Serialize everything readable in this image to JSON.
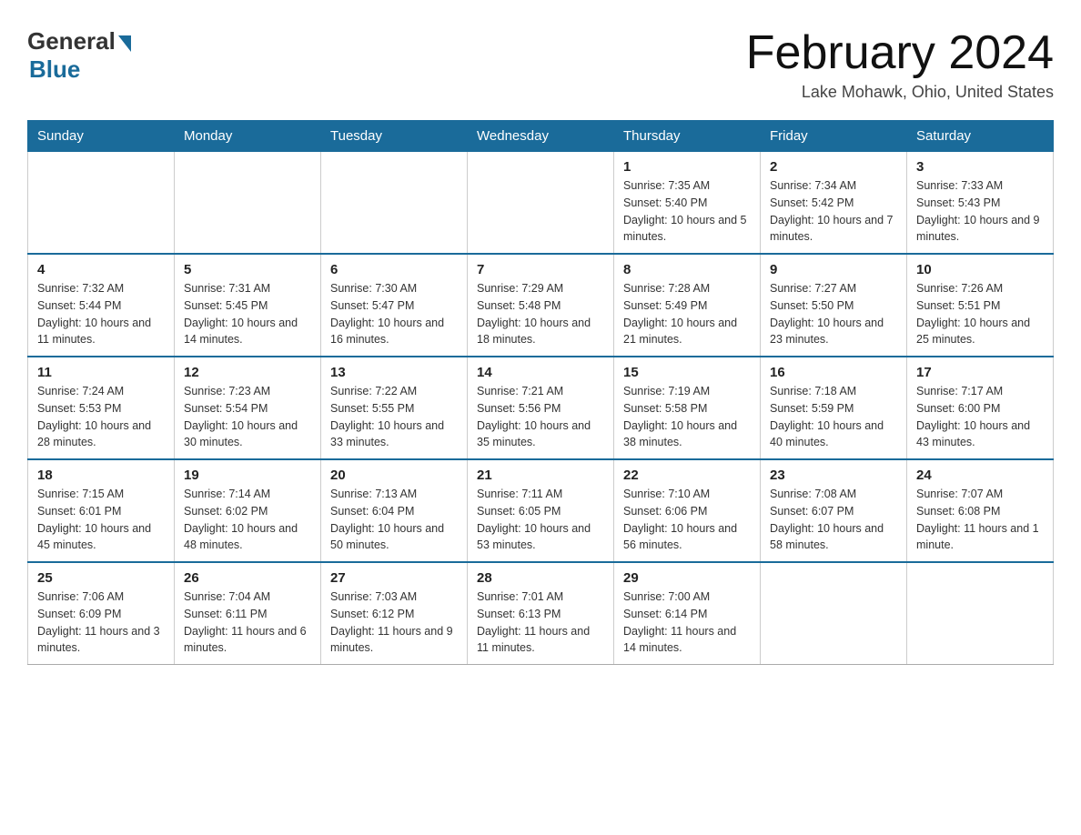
{
  "header": {
    "logo": {
      "text_general": "General",
      "text_blue": "Blue"
    },
    "title": "February 2024",
    "location": "Lake Mohawk, Ohio, United States"
  },
  "days_of_week": [
    "Sunday",
    "Monday",
    "Tuesday",
    "Wednesday",
    "Thursday",
    "Friday",
    "Saturday"
  ],
  "weeks": [
    {
      "days": [
        {
          "number": "",
          "info": ""
        },
        {
          "number": "",
          "info": ""
        },
        {
          "number": "",
          "info": ""
        },
        {
          "number": "",
          "info": ""
        },
        {
          "number": "1",
          "info": "Sunrise: 7:35 AM\nSunset: 5:40 PM\nDaylight: 10 hours and 5 minutes."
        },
        {
          "number": "2",
          "info": "Sunrise: 7:34 AM\nSunset: 5:42 PM\nDaylight: 10 hours and 7 minutes."
        },
        {
          "number": "3",
          "info": "Sunrise: 7:33 AM\nSunset: 5:43 PM\nDaylight: 10 hours and 9 minutes."
        }
      ]
    },
    {
      "days": [
        {
          "number": "4",
          "info": "Sunrise: 7:32 AM\nSunset: 5:44 PM\nDaylight: 10 hours and 11 minutes."
        },
        {
          "number": "5",
          "info": "Sunrise: 7:31 AM\nSunset: 5:45 PM\nDaylight: 10 hours and 14 minutes."
        },
        {
          "number": "6",
          "info": "Sunrise: 7:30 AM\nSunset: 5:47 PM\nDaylight: 10 hours and 16 minutes."
        },
        {
          "number": "7",
          "info": "Sunrise: 7:29 AM\nSunset: 5:48 PM\nDaylight: 10 hours and 18 minutes."
        },
        {
          "number": "8",
          "info": "Sunrise: 7:28 AM\nSunset: 5:49 PM\nDaylight: 10 hours and 21 minutes."
        },
        {
          "number": "9",
          "info": "Sunrise: 7:27 AM\nSunset: 5:50 PM\nDaylight: 10 hours and 23 minutes."
        },
        {
          "number": "10",
          "info": "Sunrise: 7:26 AM\nSunset: 5:51 PM\nDaylight: 10 hours and 25 minutes."
        }
      ]
    },
    {
      "days": [
        {
          "number": "11",
          "info": "Sunrise: 7:24 AM\nSunset: 5:53 PM\nDaylight: 10 hours and 28 minutes."
        },
        {
          "number": "12",
          "info": "Sunrise: 7:23 AM\nSunset: 5:54 PM\nDaylight: 10 hours and 30 minutes."
        },
        {
          "number": "13",
          "info": "Sunrise: 7:22 AM\nSunset: 5:55 PM\nDaylight: 10 hours and 33 minutes."
        },
        {
          "number": "14",
          "info": "Sunrise: 7:21 AM\nSunset: 5:56 PM\nDaylight: 10 hours and 35 minutes."
        },
        {
          "number": "15",
          "info": "Sunrise: 7:19 AM\nSunset: 5:58 PM\nDaylight: 10 hours and 38 minutes."
        },
        {
          "number": "16",
          "info": "Sunrise: 7:18 AM\nSunset: 5:59 PM\nDaylight: 10 hours and 40 minutes."
        },
        {
          "number": "17",
          "info": "Sunrise: 7:17 AM\nSunset: 6:00 PM\nDaylight: 10 hours and 43 minutes."
        }
      ]
    },
    {
      "days": [
        {
          "number": "18",
          "info": "Sunrise: 7:15 AM\nSunset: 6:01 PM\nDaylight: 10 hours and 45 minutes."
        },
        {
          "number": "19",
          "info": "Sunrise: 7:14 AM\nSunset: 6:02 PM\nDaylight: 10 hours and 48 minutes."
        },
        {
          "number": "20",
          "info": "Sunrise: 7:13 AM\nSunset: 6:04 PM\nDaylight: 10 hours and 50 minutes."
        },
        {
          "number": "21",
          "info": "Sunrise: 7:11 AM\nSunset: 6:05 PM\nDaylight: 10 hours and 53 minutes."
        },
        {
          "number": "22",
          "info": "Sunrise: 7:10 AM\nSunset: 6:06 PM\nDaylight: 10 hours and 56 minutes."
        },
        {
          "number": "23",
          "info": "Sunrise: 7:08 AM\nSunset: 6:07 PM\nDaylight: 10 hours and 58 minutes."
        },
        {
          "number": "24",
          "info": "Sunrise: 7:07 AM\nSunset: 6:08 PM\nDaylight: 11 hours and 1 minute."
        }
      ]
    },
    {
      "days": [
        {
          "number": "25",
          "info": "Sunrise: 7:06 AM\nSunset: 6:09 PM\nDaylight: 11 hours and 3 minutes."
        },
        {
          "number": "26",
          "info": "Sunrise: 7:04 AM\nSunset: 6:11 PM\nDaylight: 11 hours and 6 minutes."
        },
        {
          "number": "27",
          "info": "Sunrise: 7:03 AM\nSunset: 6:12 PM\nDaylight: 11 hours and 9 minutes."
        },
        {
          "number": "28",
          "info": "Sunrise: 7:01 AM\nSunset: 6:13 PM\nDaylight: 11 hours and 11 minutes."
        },
        {
          "number": "29",
          "info": "Sunrise: 7:00 AM\nSunset: 6:14 PM\nDaylight: 11 hours and 14 minutes."
        },
        {
          "number": "",
          "info": ""
        },
        {
          "number": "",
          "info": ""
        }
      ]
    }
  ]
}
